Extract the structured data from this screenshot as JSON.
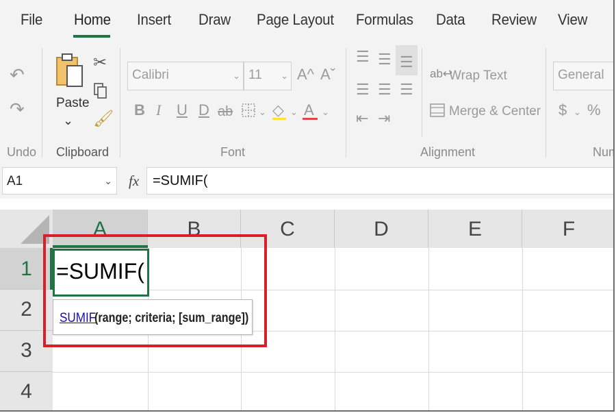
{
  "ribbon_tabs": [
    "File",
    "Home",
    "Insert",
    "Draw",
    "Page Layout",
    "Formulas",
    "Data",
    "Review",
    "View"
  ],
  "active_tab": "Home",
  "groups": {
    "undo": "Undo",
    "clipboard": "Clipboard",
    "font": "Font",
    "alignment": "Alignment",
    "number": "Num"
  },
  "clipboard": {
    "paste_label": "Paste",
    "paste_arrow": "⌄"
  },
  "font": {
    "family": "Calibri",
    "size": "11",
    "bold": "B",
    "italic": "I",
    "underline": "U",
    "double_underline": "D",
    "strikethrough": "ab",
    "grow": "A^",
    "shrink": "Aˇ",
    "font_color_glyph": "A"
  },
  "alignment": {
    "wrap_text": "Wrap Text",
    "merge_center": "Merge & Center"
  },
  "number": {
    "format": "General",
    "currency": "$",
    "percent": "%"
  },
  "formula_bar": {
    "name_box": "A1",
    "fx": "fx",
    "formula": "=SUMIF("
  },
  "columns": [
    "A",
    "B",
    "C",
    "D",
    "E",
    "F"
  ],
  "rows": [
    "1",
    "2",
    "3",
    "4"
  ],
  "cell_a1": "=SUMIF(",
  "tooltip": {
    "function": "SUMIF",
    "arguments": "(range; criteria; [sum_range])"
  },
  "colors": {
    "accent_green": "#217346",
    "highlight_red": "#d9202a",
    "fill_yellow": "#ffe033",
    "font_red": "#e2444b"
  }
}
